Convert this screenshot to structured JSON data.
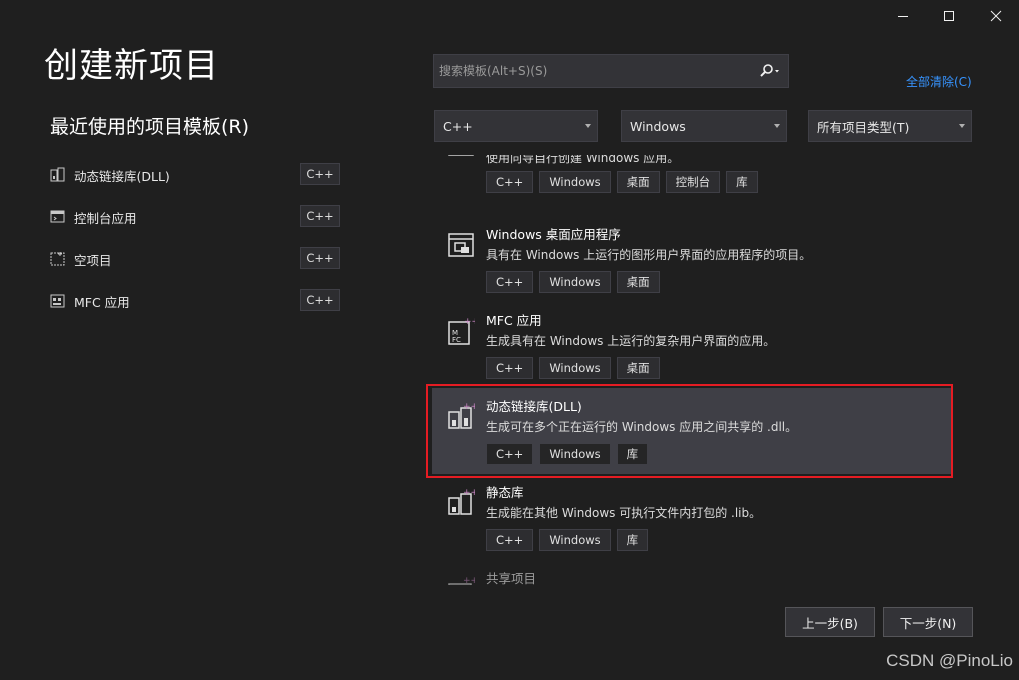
{
  "window": {
    "title": "创建新项目"
  },
  "recent": {
    "heading": "最近使用的项目模板(R)",
    "items": [
      {
        "label": "动态链接库(DLL)",
        "badge": "C++",
        "icon": "dll-icon"
      },
      {
        "label": "控制台应用",
        "badge": "C++",
        "icon": "console-app-icon"
      },
      {
        "label": "空项目",
        "badge": "C++",
        "icon": "empty-project-icon"
      },
      {
        "label": "MFC 应用",
        "badge": "C++",
        "icon": "mfc-app-icon"
      }
    ]
  },
  "search": {
    "placeholder": "搜索模板(Alt+S)(S)",
    "icon": "search-icon"
  },
  "clear_all": "全部清除(C)",
  "filters": {
    "language": "C++",
    "platform": "Windows",
    "project_type": "所有项目类型(T)"
  },
  "templates": [
    {
      "name": "",
      "desc": "使用向导自行创建 Windows 应用。",
      "tags": [
        "C++",
        "Windows",
        "桌面",
        "控制台",
        "库"
      ],
      "icon": "wizard-icon",
      "selected": false
    },
    {
      "name": "Windows 桌面应用程序",
      "desc": "具有在 Windows 上运行的图形用户界面的应用程序的项目。",
      "tags": [
        "C++",
        "Windows",
        "桌面"
      ],
      "icon": "windows-desktop-app-icon",
      "selected": false
    },
    {
      "name": "MFC 应用",
      "desc": "生成具有在 Windows 上运行的复杂用户界面的应用。",
      "tags": [
        "C++",
        "Windows",
        "桌面"
      ],
      "icon": "mfc-app-icon",
      "selected": false
    },
    {
      "name": "动态链接库(DLL)",
      "desc": "生成可在多个正在运行的 Windows 应用之间共享的 .dll。",
      "tags": [
        "C++",
        "Windows",
        "库"
      ],
      "icon": "dll-icon",
      "selected": true
    },
    {
      "name": "静态库",
      "desc": "生成能在其他 Windows 可执行文件内打包的 .lib。",
      "tags": [
        "C++",
        "Windows",
        "库"
      ],
      "icon": "static-library-icon",
      "selected": false
    },
    {
      "name": "共享项目",
      "desc": "",
      "tags": [],
      "icon": "shared-project-icon",
      "selected": false
    }
  ],
  "buttons": {
    "back": "上一步(B)",
    "next": "下一步(N)"
  },
  "watermark": "CSDN @PinoLio",
  "colors": {
    "background": "#1f1f1f",
    "accent_link": "#3794ff",
    "selection_outline": "#e51c23",
    "selected_row": "#3f3f46"
  }
}
